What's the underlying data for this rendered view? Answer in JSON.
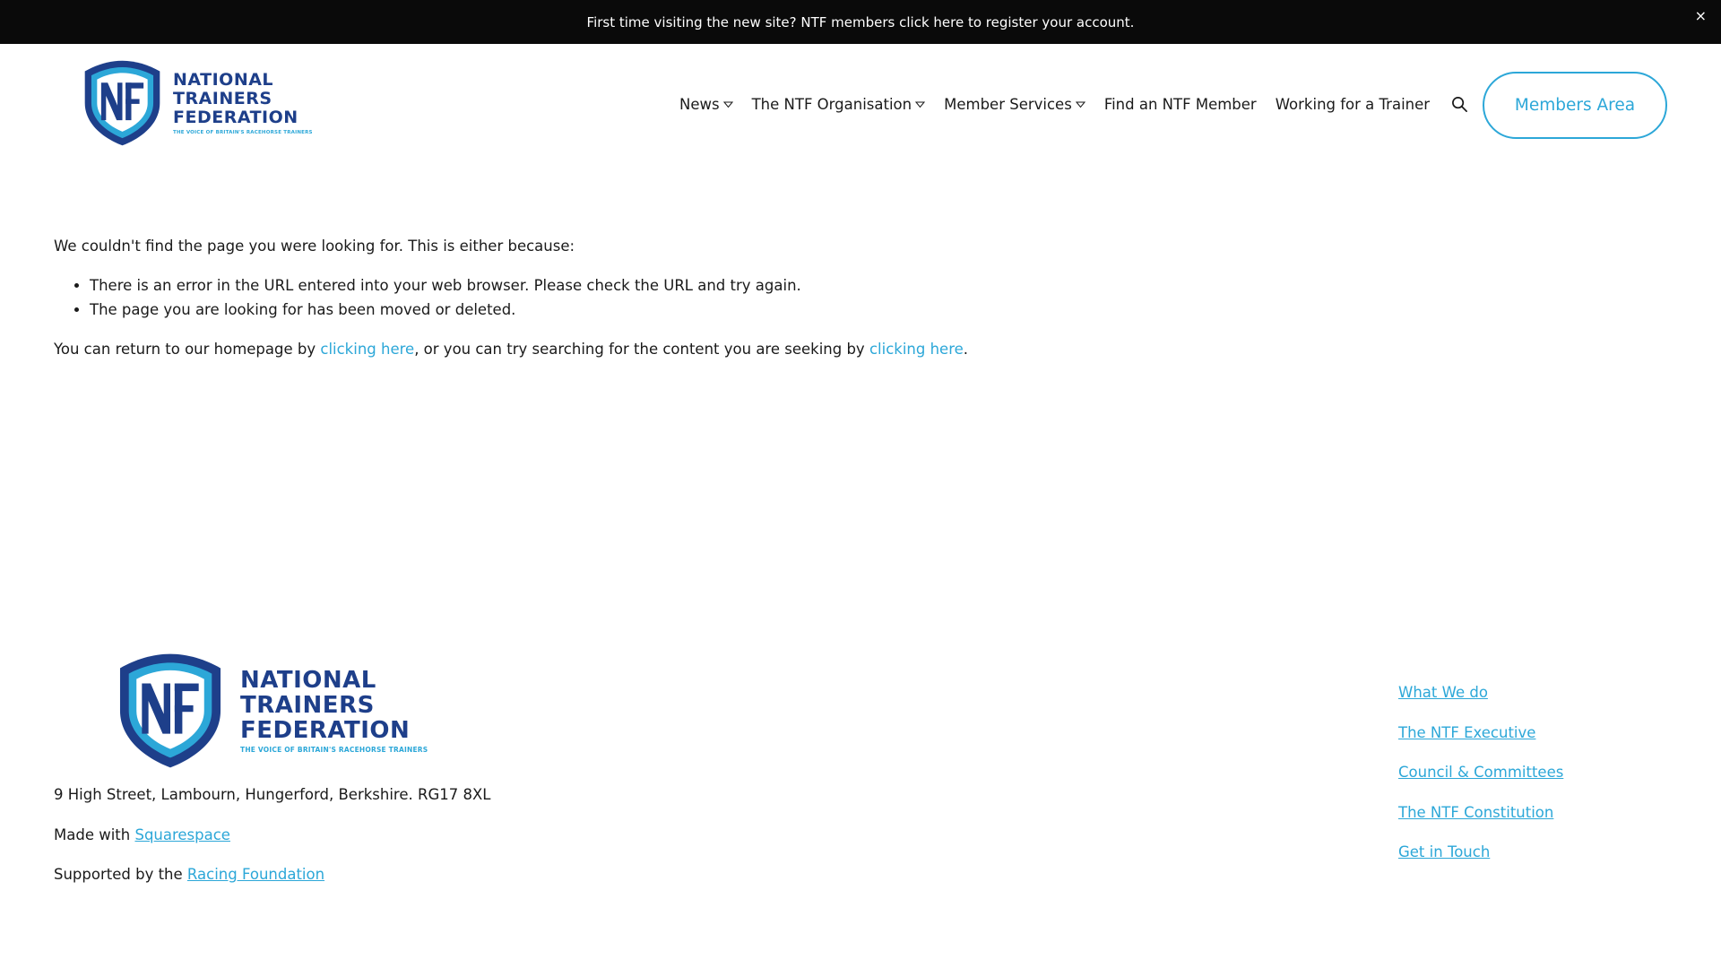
{
  "announcement": {
    "text": "First time visiting the new site? NTF members click here to register your account.",
    "close": "×"
  },
  "logo": {
    "line1": "NATIONAL",
    "line2": "TRAINERS",
    "line3": "FEDERATION",
    "tagline": "THE VOICE OF BRITAIN'S RACEHORSE TRAINERS",
    "badge": "NTF"
  },
  "nav": {
    "items": [
      {
        "label": "News",
        "dropdown": true
      },
      {
        "label": "The NTF Organisation",
        "dropdown": true
      },
      {
        "label": "Member Services",
        "dropdown": true
      },
      {
        "label": "Find an NTF Member",
        "dropdown": false
      },
      {
        "label": "Working for a Trainer",
        "dropdown": false
      }
    ],
    "search_icon": "search-icon",
    "chevron_icon": "chevron-down-icon"
  },
  "members_button": "Members Area",
  "main": {
    "intro": "We couldn't find the page you were looking for. This is either because:",
    "reasons": [
      "There is an error in the URL entered into your web browser. Please check the URL and try again.",
      "The page you are looking for has been moved or deleted."
    ],
    "return_before": "You can return to our homepage by ",
    "link1": "clicking here",
    "return_middle": ", or you can try searching for the content you are seeking by ",
    "link2": "clicking here",
    "return_after": "."
  },
  "footer": {
    "address": "9 High Street, Lambourn, Hungerford, Berkshire. RG17 8XL",
    "made_with_prefix": "Made with ",
    "made_with_link": "Squarespace",
    "supported_prefix": "Supported by the ",
    "supported_link": "Racing Foundation",
    "links": [
      "What We do",
      "The NTF Executive",
      "Council & Committees",
      "The NTF Constitution",
      "Get in Touch"
    ]
  },
  "colors": {
    "brand_navy": "#1e3f8a",
    "brand_cyan": "#2ca7d8",
    "announcement_bg": "#0a0a0a"
  }
}
